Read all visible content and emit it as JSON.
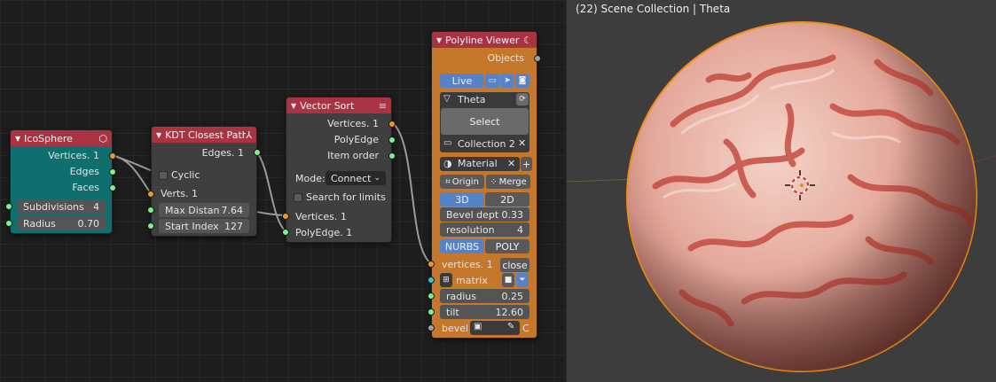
{
  "viewport": {
    "title": "(22) Scene Collection | Theta"
  },
  "nodes": {
    "icosphere": {
      "title": "IcoSphere",
      "outputs": [
        "Vertices. 1",
        "Edges",
        "Faces"
      ],
      "fields": [
        {
          "label": "Subdivisions",
          "value": "4"
        },
        {
          "label": "Radius",
          "value": "0.70"
        }
      ],
      "color": "#0f6e6e"
    },
    "kdt": {
      "title": "KDT Closest Path",
      "output": "Edges. 1",
      "cyclic_label": "Cyclic",
      "verts_input": "Verts. 1",
      "fields": [
        {
          "label": "Max Distan",
          "value": "7.64"
        },
        {
          "label": "Start Index",
          "value": "127"
        }
      ]
    },
    "vector_sort": {
      "title": "Vector Sort",
      "outputs": [
        "Vertices. 1",
        "PolyEdge",
        "Item order"
      ],
      "mode_label": "Mode:",
      "mode_value": "Connect",
      "search_label": "Search for limits",
      "inputs": [
        "Vertices. 1",
        "PolyEdge. 1"
      ]
    },
    "polyline_viewer": {
      "title": "Polyline Viewer",
      "output": "Objects",
      "live_label": "Live",
      "object_name": "Theta",
      "select_label": "Select",
      "collection_name": "Collection 2",
      "material_name": "Material",
      "origin_label": "Origin",
      "merge_label": "Merge",
      "mode_3d": "3D",
      "mode_2d": "2D",
      "bevel_depth_label": "Bevel dept",
      "bevel_depth_value": "0.33",
      "resolution_label": "resolution",
      "resolution_value": "4",
      "nurbs_label": "NURBS",
      "poly_label": "POLY",
      "vertices_input": "vertices. 1",
      "close_label": "close",
      "matrix_label": "matrix",
      "radius_label": "radius",
      "radius_value": "0.25",
      "tilt_label": "tilt",
      "tilt_value": "12.60",
      "bevel_label": "bevel",
      "bevel_suffix": "C"
    }
  },
  "colors": {
    "header_red": "#a83342",
    "socket_orange": "#e89b2d",
    "socket_green": "#7cf08b",
    "viewer_orange": "#c5772b",
    "selected_blue": "#5683c8"
  }
}
